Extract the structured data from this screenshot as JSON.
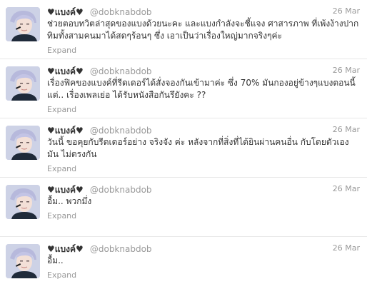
{
  "tweets": [
    {
      "fullname": "♥แบงค์♥",
      "username": "@dobknabdob",
      "time": "26 Mar",
      "text": "ช่วยตอบทวิตล่าสุดของแบงด้วยนะคะ และแบงกำลังจะชี้แจง ศาสารภาพ ที่เพ้งง้างปากทิมทั้งสามคนมาได้สดๆร้อนๆ ซึ่ง เอาเป็นว่าเรื่องใหญ่มากจริงๆค่ะ",
      "expand": "Expand"
    },
    {
      "fullname": "♥แบงค์♥",
      "username": "@dobknabdob",
      "time": "26 Mar",
      "text": "เรื่องฟิคของแบงค์ที่รีดเดอร์ได้สั่งจองกันเข้ามาค่ะ ซึ่ง 70% มันกองอยู่ข้างๆแบงตอนนี้ แต่.. เรื่องเพลเย่อ ได้รับหนังสือกันรึยังคะ ??",
      "expand": "Expand"
    },
    {
      "fullname": "♥แบงค์♥",
      "username": "@dobknabdob",
      "time": "26 Mar",
      "text": "วันนี้ ขอคุยกับรีดเดอร์อย่าง จริงจัง ค่ะ หลังจากที่สิ่งที่ได้ยินผ่านคนอื่น กับโดยตัวเอง มัน ไม่ตรงกัน",
      "expand": "Expand"
    },
    {
      "fullname": "♥แบงค์♥",
      "username": "@dobknabdob",
      "time": "26 Mar",
      "text": "อื้ม.. พวกมึ่ง",
      "expand": "Expand"
    },
    {
      "fullname": "♥แบงค์♥",
      "username": "@dobknabdob",
      "time": "26 Mar",
      "text": "อื้ม..",
      "expand": "Expand"
    }
  ]
}
